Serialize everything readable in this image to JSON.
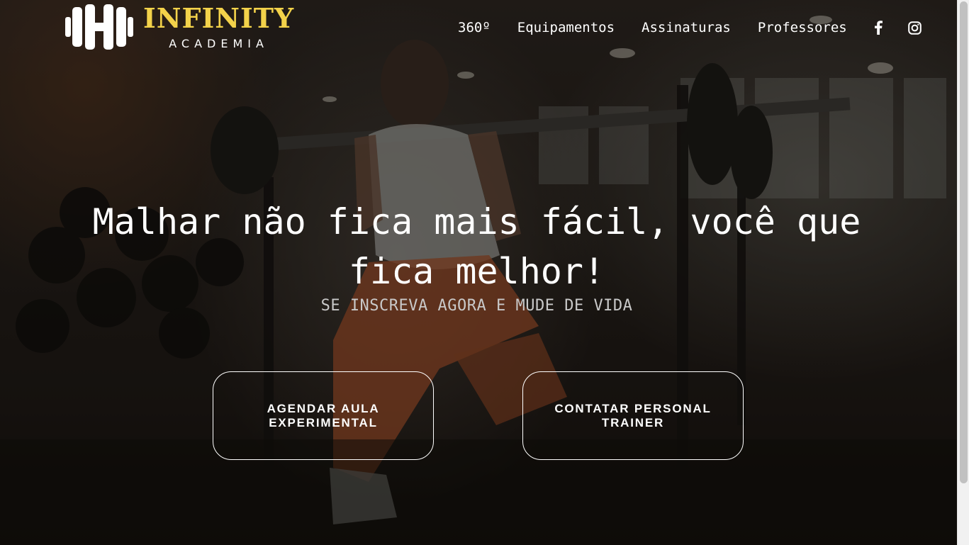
{
  "brand": {
    "name": "INFINITY",
    "tagline": "ACADEMIA",
    "colors": {
      "accent": "#f3d24a",
      "text": "#ffffff",
      "muted": "#c9c9c9"
    }
  },
  "nav": {
    "items": [
      {
        "label": "360º"
      },
      {
        "label": "Equipamentos"
      },
      {
        "label": "Assinaturas"
      },
      {
        "label": "Professores"
      }
    ],
    "social": [
      {
        "icon": "facebook-icon"
      },
      {
        "icon": "instagram-icon"
      }
    ]
  },
  "hero": {
    "headline": "Malhar não fica mais fácil, você que fica melhor!",
    "subheadline": "SE INSCREVA AGORA E MUDE DE VIDA",
    "buttons": [
      {
        "label": "AGENDAR AULA EXPERIMENTAL"
      },
      {
        "label": "CONTATAR PERSONAL TRAINER"
      }
    ]
  }
}
